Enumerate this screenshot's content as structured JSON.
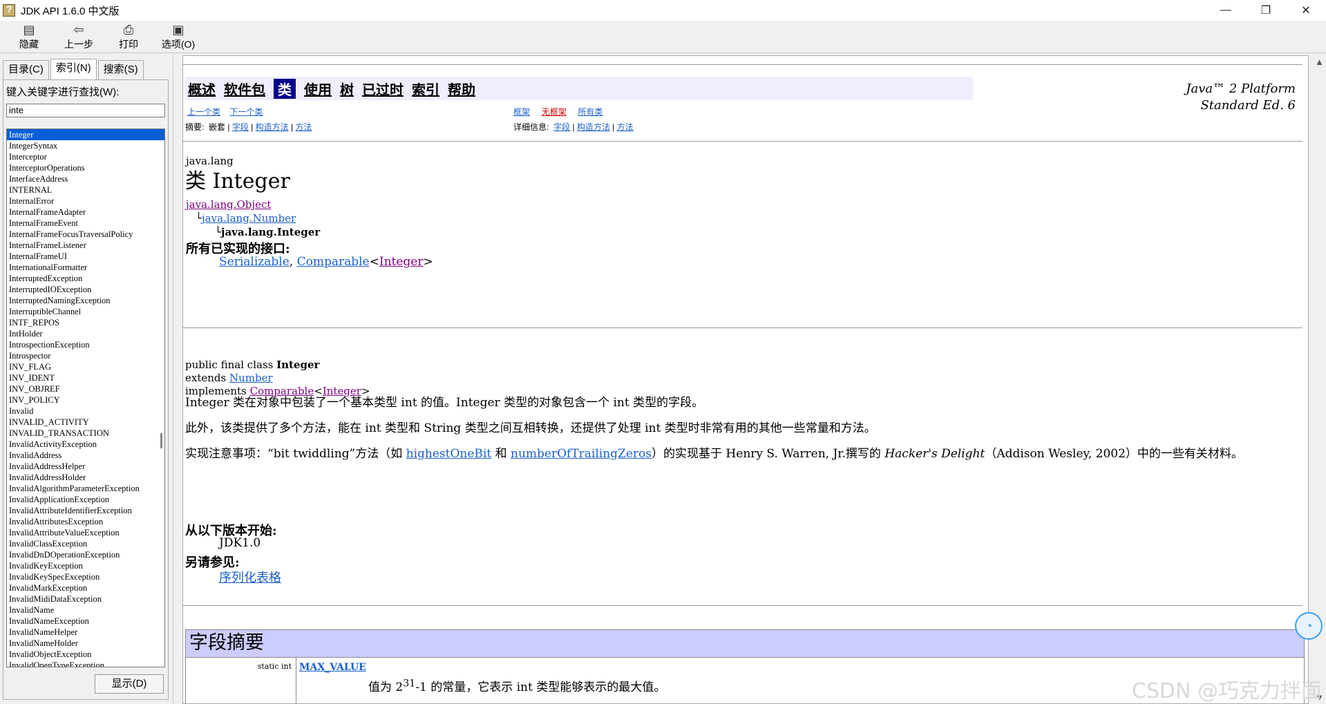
{
  "window": {
    "title": "JDK API 1.6.0 中文版",
    "minimize": "—",
    "maximize": "❐",
    "close": "✕"
  },
  "toolbar": {
    "hide": "隐藏",
    "back": "上一步",
    "print": "打印",
    "options": "选项(O)"
  },
  "left": {
    "tabs": [
      "目录(C)",
      "索引(N)",
      "搜索(S)"
    ],
    "active_tab": 1,
    "keyword_label": "键入关键字进行查找(W):",
    "keyword_value": "inte",
    "items": [
      "Integer",
      "IntegerSyntax",
      "Interceptor",
      "InterceptorOperations",
      "InterfaceAddress",
      "INTERNAL",
      "InternalError",
      "InternalFrameAdapter",
      "InternalFrameEvent",
      "InternalFrameFocusTraversalPolicy",
      "InternalFrameListener",
      "InternalFrameUI",
      "InternationalFormatter",
      "InterruptedException",
      "InterruptedIOException",
      "InterruptedNamingException",
      "InterruptibleChannel",
      "INTF_REPOS",
      "IntHolder",
      "IntrospectionException",
      "Introspector",
      "INV_FLAG",
      "INV_IDENT",
      "INV_OBJREF",
      "INV_POLICY",
      "Invalid",
      "INVALID_ACTIVITY",
      "INVALID_TRANSACTION",
      "InvalidActivityException",
      "InvalidAddress",
      "InvalidAddressHelper",
      "InvalidAddressHolder",
      "InvalidAlgorithmParameterException",
      "InvalidApplicationException",
      "InvalidAttributeIdentifierException",
      "InvalidAttributesException",
      "InvalidAttributeValueException",
      "InvalidClassException",
      "InvalidDnDOperationException",
      "InvalidKeyException",
      "InvalidKeySpecException",
      "InvalidMarkException",
      "InvalidMidiDataException",
      "InvalidName",
      "InvalidNameException",
      "InvalidNameHelper",
      "InvalidNameHolder",
      "InvalidObjectException",
      "InvalidOpenTypeException"
    ],
    "show_button": "显示(D)"
  },
  "nav": {
    "items": [
      "概述",
      "软件包",
      "类",
      "使用",
      "树",
      "已过时",
      "索引",
      "帮助"
    ],
    "current": "类",
    "platform_line1": "Java™ 2 Platform",
    "platform_line2": "Standard Ed. 6",
    "prev_class": "上一个类",
    "next_class": "下一个类",
    "frames": "框架",
    "no_frames": "无框架",
    "all_classes": "所有类",
    "summary_label": "摘要:",
    "nested": "嵌套",
    "field": "字段",
    "constructor": "构造方法",
    "method": "方法",
    "detail_label": "详细信息:"
  },
  "doc": {
    "package": "java.lang",
    "class_title": "类 Integer",
    "hier_object": "java.lang.Object",
    "hier_number": "java.lang.Number",
    "hier_integer": "java.lang.Integer",
    "interfaces_heading": "所有已实现的接口:",
    "iface_serializable": "Serializable",
    "iface_comparable": "Comparable",
    "iface_integer": "Integer",
    "decl_line1_prefix": "public final class ",
    "decl_line1_name": "Integer",
    "decl_extends": "extends ",
    "decl_number": "Number",
    "decl_implements": "implements ",
    "decl_comparable": "Comparable",
    "decl_integer": "Integer",
    "para1": "Integer 类在对象中包装了一个基本类型 int 的值。Integer 类型的对象包含一个 int 类型的字段。",
    "para2": "此外，该类提供了多个方法，能在 int 类型和 String 类型之间互相转换，还提供了处理 int 类型时非常有用的其他一些常量和方法。",
    "para3_a": "实现注意事项：“bit twiddling”方法（如 ",
    "para3_link1": "highestOneBit",
    "para3_b": " 和 ",
    "para3_link2": "numberOfTrailingZeros",
    "para3_c": "）的实现基于 Henry S. Warren, Jr.撰写的 ",
    "para3_book": "Hacker's Delight",
    "para3_d": "（Addison Wesley, 2002）中的一些有关材料。",
    "since_heading": "从以下版本开始:",
    "since_value": "JDK1.0",
    "see_heading": "另请参见:",
    "see_value": "序列化表格",
    "field_summary_heading": "字段摘要",
    "field_type": "static int",
    "field_name": "MAX_VALUE",
    "field_desc_a": "值为 2",
    "field_desc_sup": "31",
    "field_desc_b": "-1 的常量，它表示 int 类型能够表示的最大值。"
  },
  "watermark": "CSDN @巧克力拌面"
}
